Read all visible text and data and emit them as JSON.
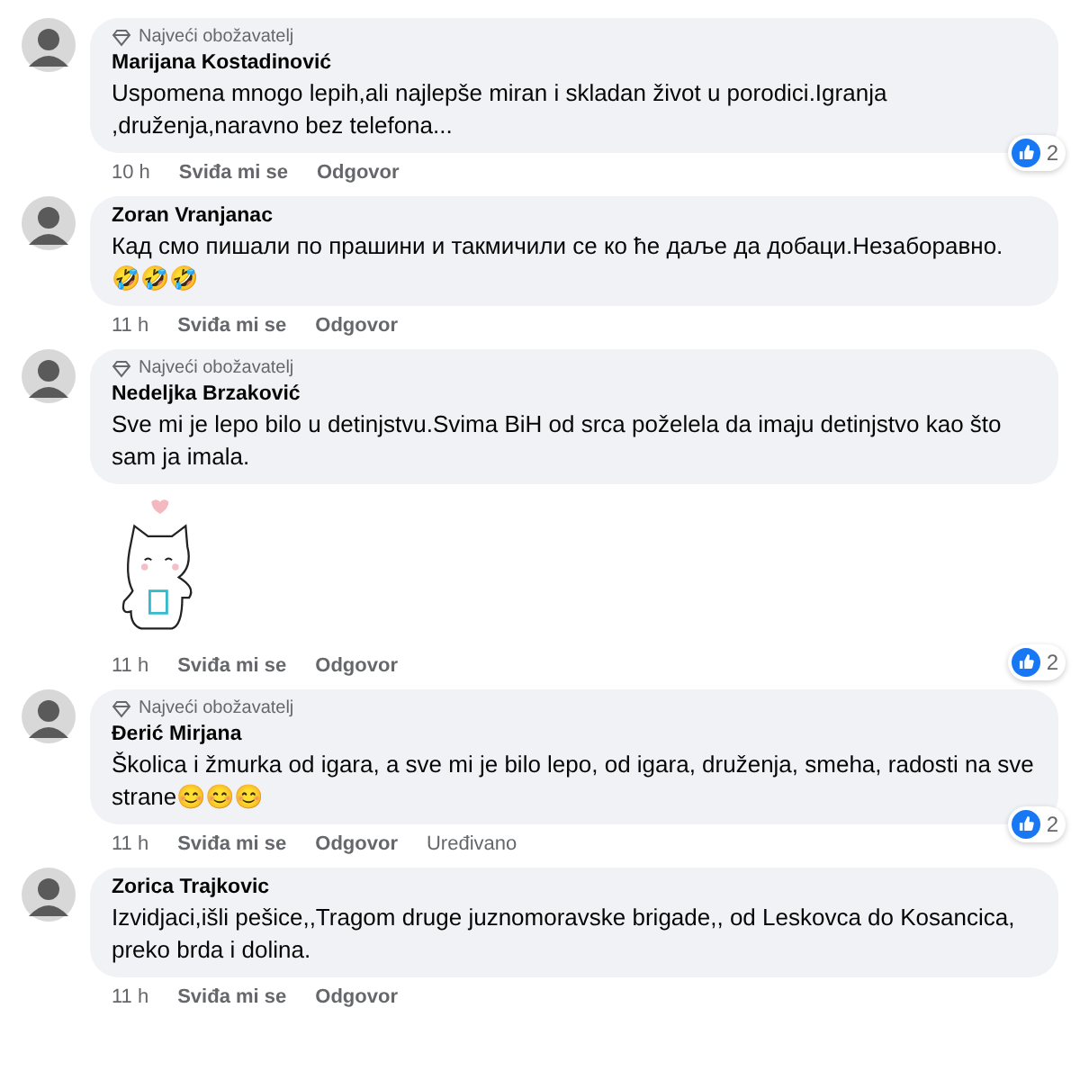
{
  "comments": [
    {
      "badge": "Najveći obožavatelj",
      "name": "Marijana Kostadinović",
      "text": "Uspomena mnogo lepih,ali najlepše miran i skladan život u porodici.Igranja ,druženja,naravno bez telefona...",
      "time": "10 h",
      "like": "Sviđa mi se",
      "reply": "Odgovor",
      "reactions": "2"
    },
    {
      "name": "Zoran Vranjanac",
      "text": "Кад смо пишали по прашини и такмичили се ко ће даље да добаци.Незаборавно.",
      "emoji": "🤣🤣🤣",
      "time": "11 h",
      "like": "Sviđa mi se",
      "reply": "Odgovor"
    },
    {
      "badge": "Najveći obožavatelj",
      "name": "Nedeljka Brzaković",
      "text": "Sve mi je lepo bilo u detinjstvu.Svima BiH od srca poželela da imaju detinjstvo kao što sam ja imala.",
      "attachment": {
        "kind": "sticker"
      },
      "time": "11 h",
      "like": "Sviđa mi se",
      "reply": "Odgovor",
      "reactions": "2"
    },
    {
      "badge": "Najveći obožavatelj",
      "name": "Đerić Mirjana",
      "text": "Školica i žmurka od igara, a sve mi je bilo lepo, od igara, druženja, smeha, radosti na sve strane😊😊😊",
      "time": "11 h",
      "like": "Sviđa mi se",
      "reply": "Odgovor",
      "edited": "Uređivano",
      "reactions": "2"
    },
    {
      "name": "Zorica Trajkovic",
      "text": "Izvidjaci,išli pešice,,Tragom druge juznomoravske brigade,, od Leskovca do Kosancica, preko brda i dolina.",
      "time": "11 h",
      "like": "Sviđa mi se",
      "reply": "Odgovor"
    }
  ]
}
